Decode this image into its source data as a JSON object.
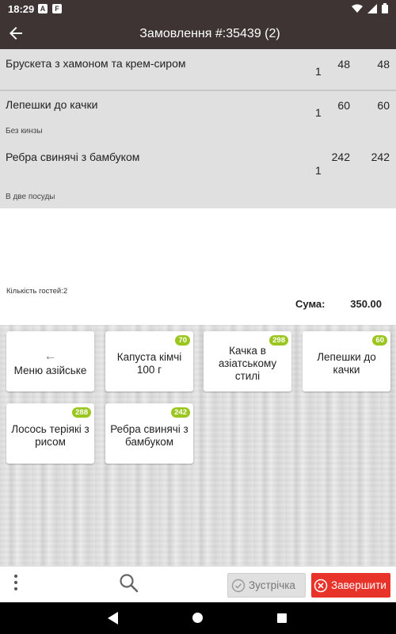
{
  "status_bar": {
    "time": "18:29",
    "icon_a": "A",
    "icon_f": "F"
  },
  "appbar": {
    "title": "Замовлення #:35439 (2)"
  },
  "orders": [
    {
      "name": "Брускета з хамоном та крем-сиром",
      "qty": "1",
      "price": "48",
      "total": "48",
      "note": ""
    },
    {
      "name": "Лепешки до качки",
      "qty": "1",
      "price": "60",
      "total": "60",
      "note": "Без кинзы"
    },
    {
      "name": "Ребра свинячі з бамбуком",
      "qty": "1",
      "price": "242",
      "total": "242",
      "note": "В две посуды"
    }
  ],
  "summary": {
    "guests": "Кількість гостей:2",
    "sum_label": "Сума:",
    "sum_value": "350.00"
  },
  "menu": {
    "back_tile": "Меню азійське",
    "tiles": [
      {
        "label": "Капуста кімчі 100 г",
        "badge": "70"
      },
      {
        "label": "Качка в азіатському стилі",
        "badge": "298"
      },
      {
        "label": "Лепешки до качки",
        "badge": "60"
      },
      {
        "label": "Лосось теріякі з рисом",
        "badge": "288"
      },
      {
        "label": "Ребра свинячі з бамбуком",
        "badge": "242"
      }
    ]
  },
  "bottom": {
    "meet_label": "Зустрічка",
    "finish_label": "Завершити"
  },
  "colors": {
    "bar": "#3e3434",
    "badge": "#9bc61f",
    "finish": "#e8332b",
    "orders_bg": "#e0e0e0"
  }
}
